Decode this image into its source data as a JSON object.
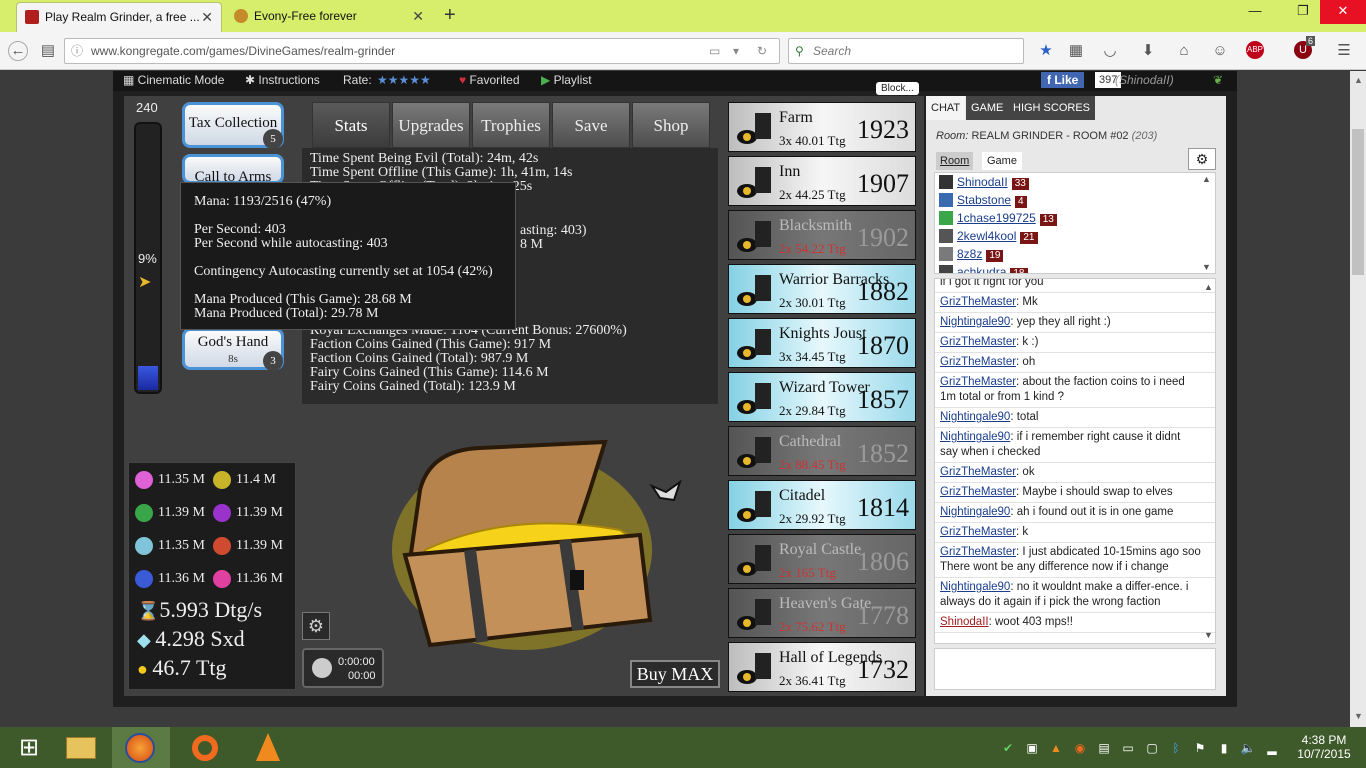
{
  "browser": {
    "tabs": [
      {
        "label": "Play Realm Grinder, a free ...",
        "active": true
      },
      {
        "label": "Evony-Free forever",
        "active": false
      }
    ],
    "url": "www.kongregate.com/games/DivineGames/realm-grinder",
    "search_placeholder": "Search",
    "new_tab": "+",
    "addon_badge": "6"
  },
  "kong": {
    "cinematic": "Cinematic Mode",
    "instructions": "Instructions",
    "rate": "Rate:",
    "favorited": "Favorited",
    "playlist": "Playlist",
    "like": "Like",
    "like_count": "397",
    "username": "(ShinodaII)",
    "block": "Block..."
  },
  "game": {
    "mana_top": "240",
    "mana_pct": "9%",
    "mana_fill": 0.09,
    "spells": [
      {
        "label": "Tax Collection",
        "badge": "5"
      },
      {
        "label": "Call to Arms"
      },
      {
        "label": "God's Hand",
        "timer": "8s",
        "badge": "3"
      }
    ],
    "tabs": [
      "Stats",
      "Upgrades",
      "Trophies",
      "Save",
      "Shop"
    ],
    "stats_lines_top": [
      "Time Spent Being Evil (Total): 24m, 42s",
      "Time Spent Offline (This Game): 1h, 41m, 14s",
      "Time Spent Offline (Total): 2h, 1m, 25s"
    ],
    "stats_fragment_1": "asting: 403)",
    "stats_fragment_2": "8 M",
    "stats_lines_bottom": [
      "Royal Exchanges Made: 1104 (Current Bonus: 27600%)",
      "Faction Coins Gained (This Game): 917 M",
      "Faction Coins Gained (Total): 987.9 M",
      "Fairy Coins Gained (This Game): 114.6 M",
      "Fairy Coins Gained (Total): 123.9 M"
    ],
    "tooltip": {
      "mana": "Mana: 1193/2516 (47%)",
      "per_second": "Per Second: 403",
      "per_second_auto": "Per Second while autocasting: 403",
      "contingency": "Contingency Autocasting currently set at 1054 (42%)",
      "produced_game": "Mana Produced (This Game): 28.68 M",
      "produced_total": "Mana Produced (Total): 29.78 M"
    },
    "buildings": [
      {
        "name": "Farm",
        "price": "3x 40.01 Ttg",
        "count": "1923",
        "style": "light"
      },
      {
        "name": "Inn",
        "price": "2x 44.25 Ttg",
        "count": "1907",
        "style": "light"
      },
      {
        "name": "Blacksmith",
        "price": "2x 54.22 Ttg",
        "count": "1902",
        "style": "gray"
      },
      {
        "name": "Warrior Barracks",
        "price": "2x 30.01 Ttg",
        "count": "1882",
        "style": "blue"
      },
      {
        "name": "Knights Joust",
        "price": "3x 34.45 Ttg",
        "count": "1870",
        "style": "blue"
      },
      {
        "name": "Wizard Tower",
        "price": "2x 29.84 Ttg",
        "count": "1857",
        "style": "blue"
      },
      {
        "name": "Cathedral",
        "price": "2x 88.45 Ttg",
        "count": "1852",
        "style": "gray"
      },
      {
        "name": "Citadel",
        "price": "2x 29.92 Ttg",
        "count": "1814",
        "style": "blue"
      },
      {
        "name": "Royal Castle",
        "price": "2x 165 Ttg",
        "count": "1806",
        "style": "gray"
      },
      {
        "name": "Heaven's Gate",
        "price": "2x 75.62 Ttg",
        "count": "1778",
        "style": "gray"
      },
      {
        "name": "Hall of Legends",
        "price": "2x 36.41 Ttg",
        "count": "1732",
        "style": "light"
      }
    ],
    "coins": [
      {
        "value": "11.35 M",
        "color": "#e060d8"
      },
      {
        "value": "11.4 M",
        "color": "#c8b42a"
      },
      {
        "value": "11.39 M",
        "color": "#3aa64a"
      },
      {
        "value": "11.39 M",
        "color": "#9933cc"
      },
      {
        "value": "11.35 M",
        "color": "#7fc4d8"
      },
      {
        "value": "11.39 M",
        "color": "#d04a30"
      },
      {
        "value": "11.36 M",
        "color": "#3a5ad8"
      },
      {
        "value": "11.36 M",
        "color": "#e040a0"
      }
    ],
    "resources": [
      {
        "value": "5.993 Dtg/s",
        "icon": "hourglass-icon"
      },
      {
        "value": "4.298 Sxd",
        "icon": "gem-icon"
      },
      {
        "value": "46.7 Ttg",
        "icon": "gold-coin-icon"
      }
    ],
    "timer_top": "0:00:00",
    "timer_bottom": "00:00",
    "buy_max": "Buy MAX"
  },
  "chat": {
    "tabs": [
      "CHAT",
      "GAME",
      "HIGH SCORES"
    ],
    "room_label": "Room:",
    "room_name": "REALM GRINDER - ROOM #02",
    "room_count": "(203)",
    "subtabs": [
      "Room",
      "Game"
    ],
    "users": [
      {
        "name": "ShinodaII",
        "level": "33"
      },
      {
        "name": "Stabstone",
        "level": "4"
      },
      {
        "name": "1chase199725",
        "level": "13"
      },
      {
        "name": "2kewl4kool",
        "level": "21"
      },
      {
        "name": "8z8z",
        "level": "19"
      },
      {
        "name": "achkudra",
        "level": "18"
      }
    ],
    "first_line": "if i got it right for you",
    "messages": [
      {
        "name": "GrizTheMaster",
        "text": ": Mk"
      },
      {
        "name": "Nightingale90",
        "text": ": yep they all right :)"
      },
      {
        "name": "GrizTheMaster",
        "text": ": k :)"
      },
      {
        "name": "GrizTheMaster",
        "text": ": oh"
      },
      {
        "name": "GrizTheMaster",
        "text": ": about the faction coins to i need 1m total or from 1 kind ?"
      },
      {
        "name": "Nightingale90",
        "text": ": total"
      },
      {
        "name": "Nightingale90",
        "text": ": if i remember right cause it didnt say when i checked"
      },
      {
        "name": "GrizTheMaster",
        "text": ": ok"
      },
      {
        "name": "GrizTheMaster",
        "text": ": Maybe i should swap to elves"
      },
      {
        "name": "Nightingale90",
        "text": ": ah i found out it is in one game"
      },
      {
        "name": "GrizTheMaster",
        "text": ": k"
      },
      {
        "name": "GrizTheMaster",
        "text": ": I just abdicated 10-15mins ago soo There wont be any difference now if i change"
      },
      {
        "name": "Nightingale90",
        "text": ": no it wouldnt make a differ-ence. i always do it again if i pick the wrong faction"
      },
      {
        "name": "ShinodaII",
        "text": ": woot 403 mps!!",
        "self": true
      }
    ]
  },
  "taskbar": {
    "time": "4:38 PM",
    "date": "10/7/2015"
  }
}
